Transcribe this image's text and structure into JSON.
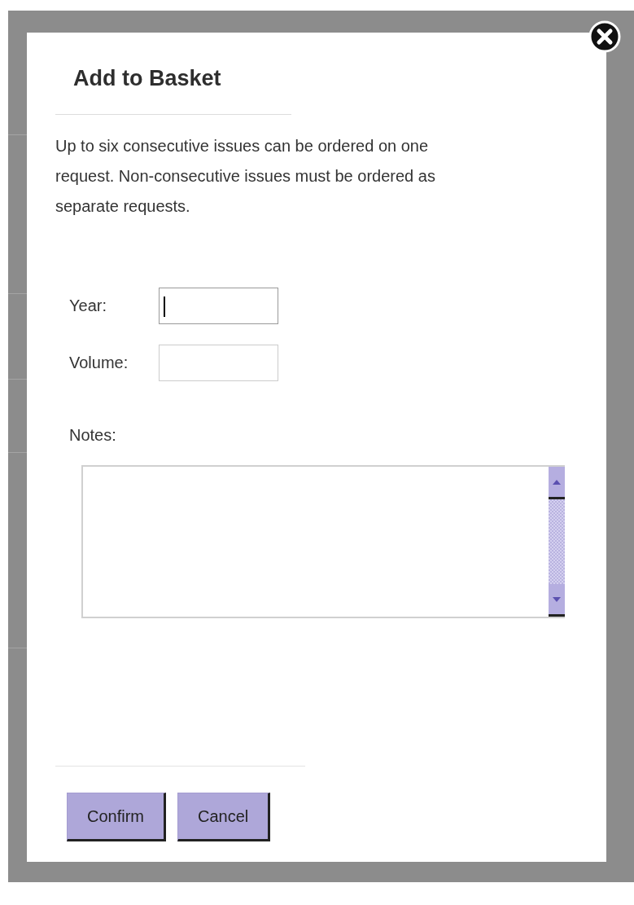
{
  "dialog": {
    "title": "Add to Basket",
    "intro": "Up to six consecutive issues can be ordered on one request. Non-consecutive issues must be ordered as separate requests.",
    "fields": [
      {
        "label": "Year:",
        "focused": true
      },
      {
        "label": "Volume:",
        "focused": false
      }
    ],
    "notes_label": "Notes:",
    "buttons": [
      "Confirm",
      "Cancel"
    ]
  }
}
